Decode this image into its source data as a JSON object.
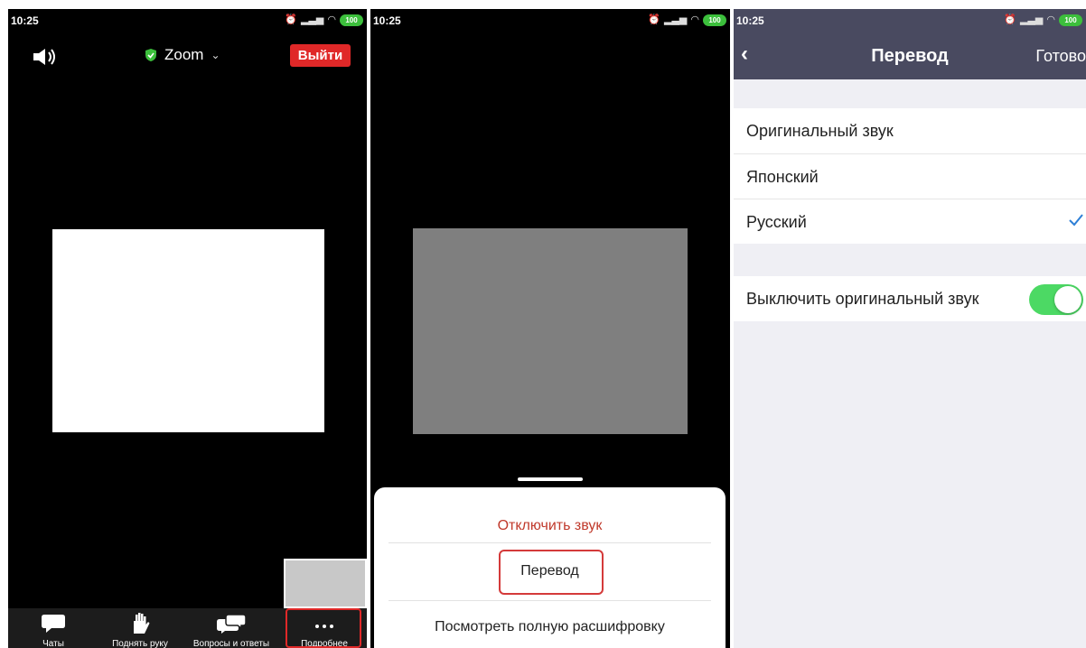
{
  "status_bar": {
    "time": "10:25",
    "battery": "100"
  },
  "meeting": {
    "title": "Zoom",
    "leave_label": "Выйти",
    "toolbar": [
      {
        "label": "Чаты",
        "icon": "chat-icon"
      },
      {
        "label": "Поднять руку",
        "icon": "hand-icon"
      },
      {
        "label": "Вопросы и ответы",
        "icon": "qa-icon"
      },
      {
        "label": "Подробнее",
        "icon": "more-icon"
      }
    ]
  },
  "sheet": {
    "mute_label": "Отключить звук",
    "translation_label": "Перевод",
    "transcript_label": "Посмотреть полную расшифровку"
  },
  "translation": {
    "title": "Перевод",
    "done_label": "Готово",
    "languages": [
      {
        "label": "Оригинальный звук",
        "selected": false
      },
      {
        "label": "Японский",
        "selected": false
      },
      {
        "label": "Русский",
        "selected": true
      }
    ],
    "mute_original_label": "Выключить оригинальный звук",
    "mute_original_on": true
  },
  "colors": {
    "accent_red": "#e02828",
    "nav": "#494a60",
    "toggle_on": "#4cd964",
    "check": "#2d7fd6"
  }
}
